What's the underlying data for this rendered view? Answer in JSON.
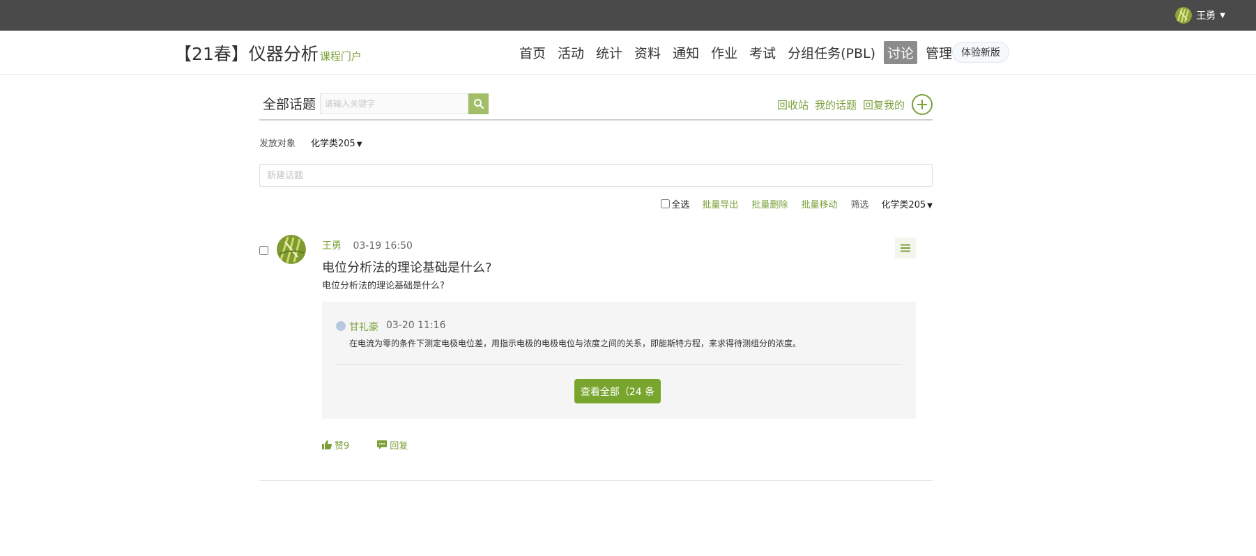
{
  "topbar": {
    "user_name": "王勇"
  },
  "header": {
    "course_title": "【21春】仪器分析",
    "portal_link": "课程门户",
    "nav": [
      "首页",
      "活动",
      "统计",
      "资料",
      "通知",
      "作业",
      "考试",
      "分组任务(PBL)",
      "讨论",
      "管理"
    ],
    "active_nav": "讨论",
    "try_new": "体验新版"
  },
  "toolbar": {
    "title": "全部话题",
    "search_placeholder": "请输入关键字",
    "links": [
      "回收站",
      "我的话题",
      "回复我的"
    ]
  },
  "target": {
    "label": "发放对象",
    "value": "化学类205"
  },
  "new_topic_placeholder": "新建话题",
  "batch": {
    "select_all": "全选",
    "export": "批量导出",
    "delete": "批量删除",
    "move": "批量移动",
    "filter_label": "筛选",
    "filter_value": "化学类205"
  },
  "topic": {
    "author": "王勇",
    "time": "03-19 16:50",
    "title": "电位分析法的理论基础是什么?",
    "body": "电位分析法的理论基础是什么?",
    "reply": {
      "author": "甘礼豪",
      "time": "03-20 11:16",
      "text": "在电流为零的条件下测定电极电位差，用指示电极的电极电位与浓度之间的关系，即能斯特方程，来求得待测组分的浓度。"
    },
    "view_all": "查看全部（24 条",
    "like": "赞9",
    "reply_label": "回复"
  },
  "colors": {
    "accent_green": "#7ba03a",
    "topbar": "#4a4a4a",
    "active_nav_bg": "#8c8c8c"
  }
}
